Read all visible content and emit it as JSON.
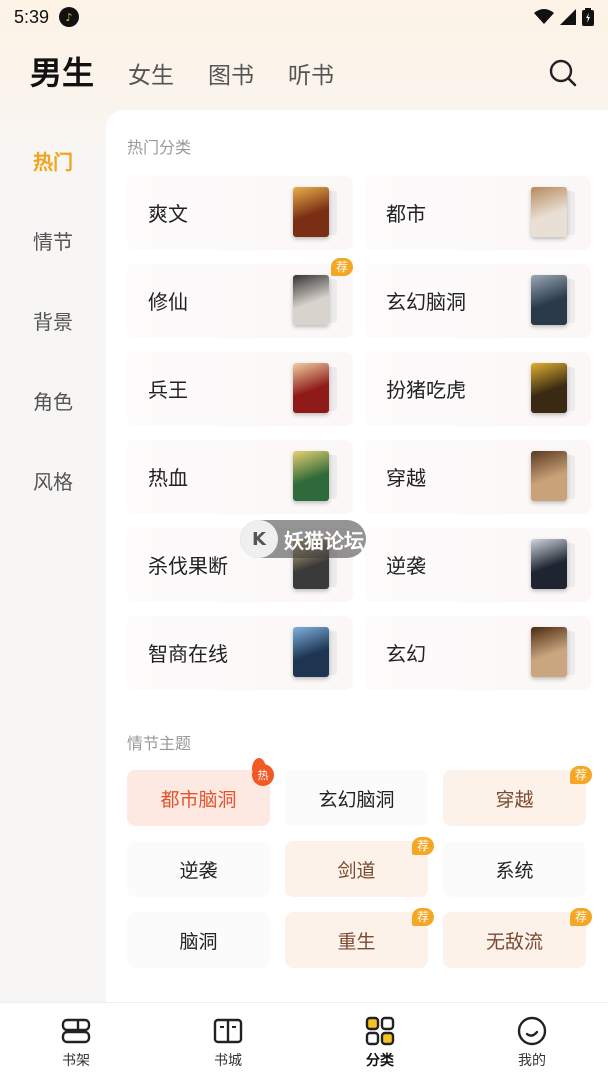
{
  "status": {
    "time": "5:39",
    "music_icon": "music-note-icon"
  },
  "tabs": [
    {
      "label": "男生",
      "active": true
    },
    {
      "label": "女生"
    },
    {
      "label": "图书"
    },
    {
      "label": "听书"
    }
  ],
  "sidebar": [
    {
      "label": "热门",
      "active": true
    },
    {
      "label": "情节"
    },
    {
      "label": "背景"
    },
    {
      "label": "角色"
    },
    {
      "label": "风格"
    }
  ],
  "hot_categories": {
    "title": "热门分类",
    "items": [
      {
        "label": "爽文",
        "cover_color": "#7a2e14",
        "cover_accent": "#e8b04a"
      },
      {
        "label": "都市",
        "cover_color": "#e9dfd4",
        "cover_accent": "#b58a5a"
      },
      {
        "label": "修仙",
        "cover_color": "#d8d3cc",
        "cover_accent": "#333333",
        "badge": "荐"
      },
      {
        "label": "玄幻脑洞",
        "cover_color": "#2a3a4a",
        "cover_accent": "#9aa8b6"
      },
      {
        "label": "兵王",
        "cover_color": "#8e1a1a",
        "cover_accent": "#f0d0a0"
      },
      {
        "label": "扮猪吃虎",
        "cover_color": "#3a2a14",
        "cover_accent": "#e0b030"
      },
      {
        "label": "热血",
        "cover_color": "#2f6b3a",
        "cover_accent": "#e8d070"
      },
      {
        "label": "穿越",
        "cover_color": "#c9a27a",
        "cover_accent": "#5a3a20"
      },
      {
        "label": "杀伐果断",
        "cover_color": "#3a3a3a",
        "cover_accent": "#d9c089"
      },
      {
        "label": "逆袭",
        "cover_color": "#1f2530",
        "cover_accent": "#d0d6e0"
      },
      {
        "label": "智商在线",
        "cover_color": "#1d3550",
        "cover_accent": "#7fb2e0"
      },
      {
        "label": "玄幻",
        "cover_color": "#caa680",
        "cover_accent": "#4a2a10"
      }
    ]
  },
  "plot_themes": {
    "title": "情节主题",
    "items": [
      {
        "label": "都市脑洞",
        "style": "hot",
        "badge": "热"
      },
      {
        "label": "玄幻脑洞",
        "style": "plain"
      },
      {
        "label": "穿越",
        "style": "warm",
        "badge": "荐"
      },
      {
        "label": "逆袭",
        "style": "plain"
      },
      {
        "label": "剑道",
        "style": "warm",
        "badge": "荐"
      },
      {
        "label": "系统",
        "style": "plain"
      },
      {
        "label": "脑洞",
        "style": "plain"
      },
      {
        "label": "重生",
        "style": "warm",
        "badge": "荐"
      },
      {
        "label": "无敌流",
        "style": "warm",
        "badge": "荐"
      }
    ]
  },
  "watermark": {
    "text": "妖猫论坛"
  },
  "bottom_nav": [
    {
      "label": "书架",
      "icon": "bookshelf-icon"
    },
    {
      "label": "书城",
      "icon": "open-book-icon"
    },
    {
      "label": "分类",
      "icon": "category-grid-icon",
      "active": true
    },
    {
      "label": "我的",
      "icon": "smile-profile-icon"
    }
  ]
}
